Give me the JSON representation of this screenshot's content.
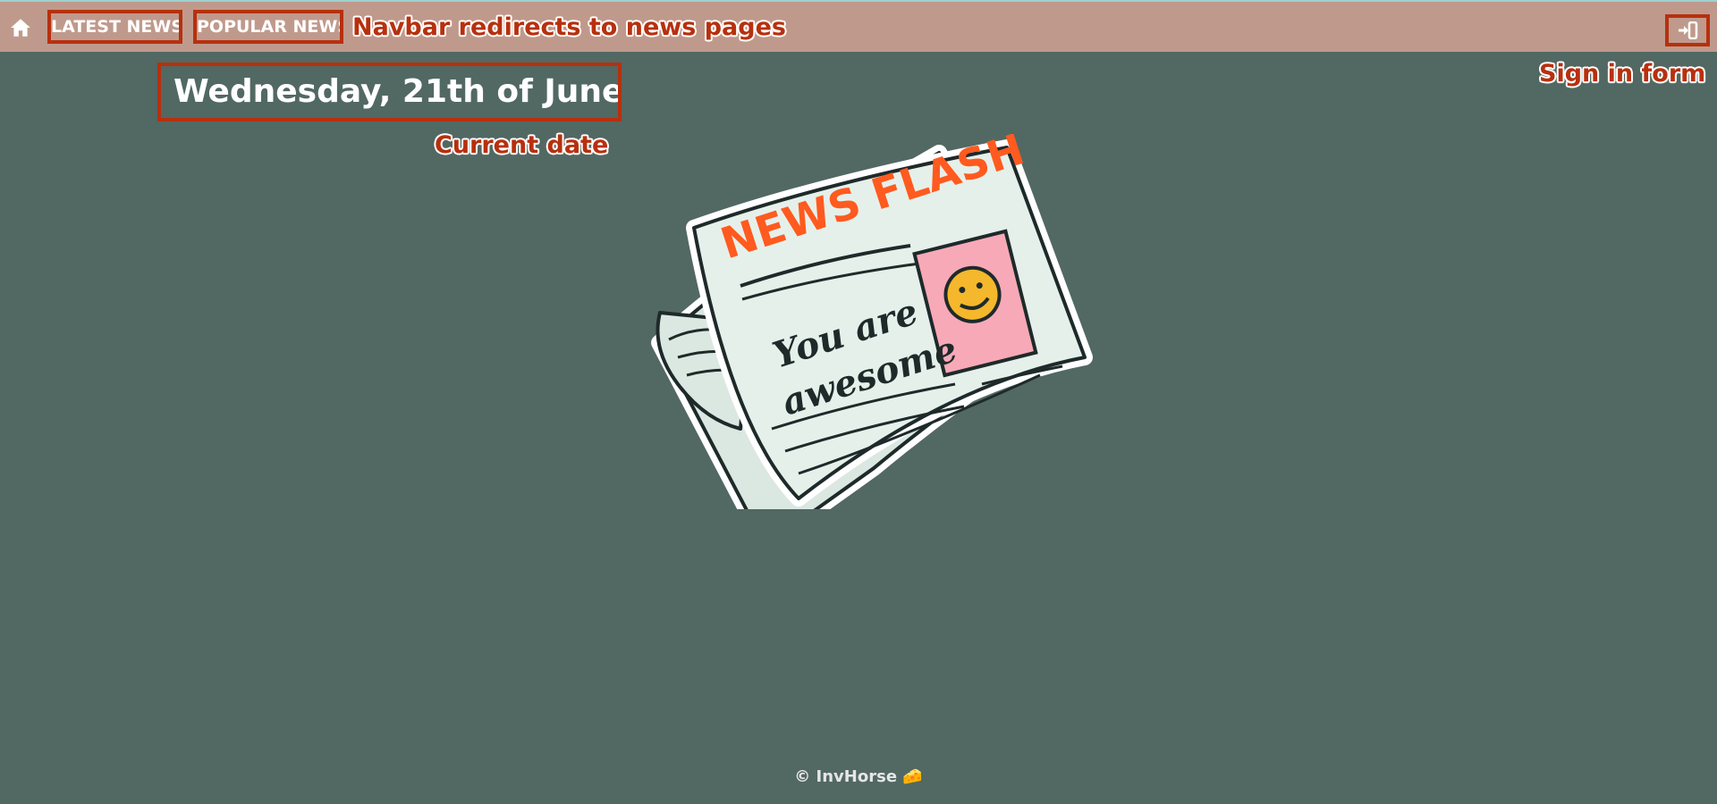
{
  "navbar": {
    "home_icon": "home-icon",
    "latest_news": "LATEST NEWS",
    "popular_news": "POPULAR NEWS",
    "signin_icon": "sign-in-icon"
  },
  "annotations": {
    "navbar": "Navbar redirects to news pages",
    "signin": "Sign in form",
    "date": "Current date"
  },
  "main": {
    "date": "Wednesday, 21th of June",
    "illustration": {
      "headline": "NEWS FLASH",
      "body_line1": "You are",
      "body_line2": "awesome"
    }
  },
  "footer": {
    "text": "© InvHorse 🧀"
  },
  "colors": {
    "background": "#526863",
    "navbar": "#bf9a8c",
    "annotation": "#b7300e",
    "headline": "#ff5a1f"
  }
}
